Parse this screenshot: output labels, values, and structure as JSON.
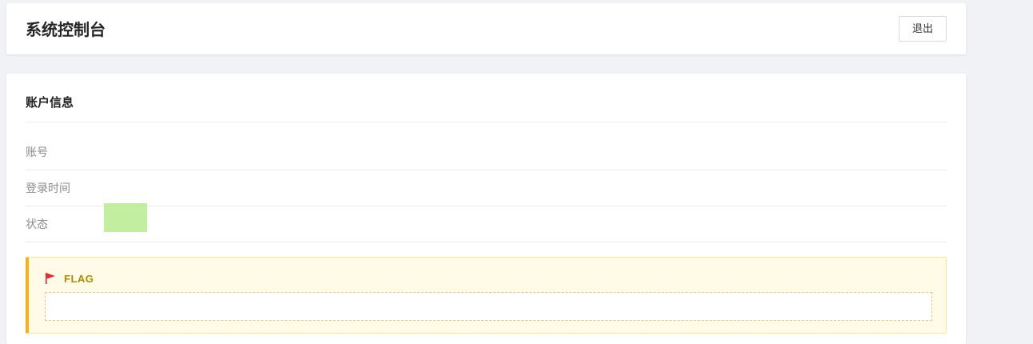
{
  "header": {
    "title": "系统控制台",
    "logout_label": "退出"
  },
  "account": {
    "section_title": "账户信息",
    "rows": [
      {
        "label": "账号",
        "value": ""
      },
      {
        "label": "登录时间",
        "value": ""
      },
      {
        "label": "状态",
        "value": ""
      }
    ]
  },
  "flag": {
    "label": "FLAG",
    "value": "",
    "icon": "flag-icon"
  },
  "colors": {
    "page_background": "#f0f2f5",
    "card_background": "#ffffff",
    "flag_background": "#fffbe6",
    "flag_border": "#ffe58f",
    "flag_accent": "#faad14",
    "flag_label_text": "#ad8b00",
    "flag_icon": "#f5222d",
    "status_badge": "#b7eb8f"
  }
}
